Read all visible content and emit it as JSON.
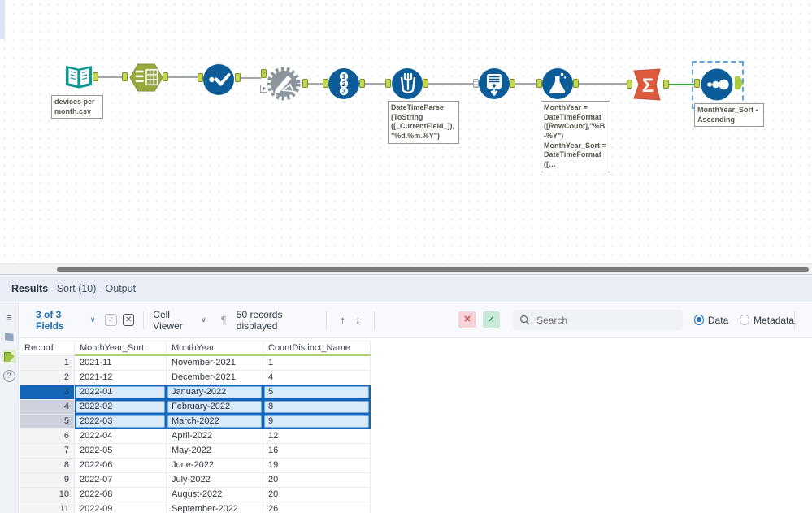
{
  "colors": {
    "tool_blue": "#0b5c99",
    "select_olive": "#98a93e",
    "input_teal": "#109a94",
    "summarize_orange": "#dd5a3e",
    "anchor_green": "#c5d653",
    "connection_green": "#37a23b",
    "selection_blue": "#1566bb",
    "selected_row_fill": "#d9eafa",
    "header_underline_green": "#a9d16d",
    "accent_blue": "#1a6fb5"
  },
  "icons": {
    "list": "≡",
    "help": "?",
    "pilcrow": "¶",
    "arrow_up": "↑",
    "arrow_down": "↓",
    "chevron_down": "∨",
    "close": "✕",
    "check": "✓",
    "names": [
      "input-data-icon",
      "select-icon",
      "unique-icon",
      "macro-gear-icon",
      "record-id-icon",
      "multi-field-formula-icon",
      "multi-row-formula-icon",
      "formula-flask-icon",
      "summarize-sigma-icon",
      "sort-icon",
      "search-icon",
      "results-anchor-icon",
      "help-icon",
      "list-icon"
    ]
  },
  "canvas": {
    "tools": [
      {
        "id": "input-data",
        "label": "devices per month.csv"
      },
      {
        "id": "select"
      },
      {
        "id": "unique"
      },
      {
        "id": "macro"
      },
      {
        "id": "record-id",
        "digits": [
          "1",
          "2",
          "3"
        ]
      },
      {
        "id": "multi-field-formula",
        "annotation": "DateTimeParse\n(ToString\n([_CurrentField_]),\n\"%d.%m.%Y\")"
      },
      {
        "id": "multi-row-formula"
      },
      {
        "id": "formula",
        "annotation": "MonthYear =\nDateTimeFormat\n([RowCount],\"%B\n-%Y\")\nMonthYear_Sort =\nDateTimeFormat\n([…"
      },
      {
        "id": "summarize",
        "glyph": "Σ"
      },
      {
        "id": "sort",
        "annotation": "MonthYear_Sort -\nAscending",
        "selected": true
      }
    ]
  },
  "results": {
    "title": "Results",
    "subtitle": "- Sort (10) - Output",
    "toolbar": {
      "fields_label": "3 of 3 Fields",
      "cell_viewer_label": "Cell Viewer",
      "records_label": "50 records displayed",
      "search_placeholder": "Search",
      "data_label": "Data",
      "metadata_label": "Metadata"
    },
    "table": {
      "columns": [
        "Record",
        "MonthYear_Sort",
        "MonthYear",
        "CountDistinct_Name"
      ],
      "rows": [
        {
          "record": "1",
          "monthyear_sort": "2021-11",
          "monthyear": "November-2021",
          "count": "1",
          "selected": false,
          "active": false
        },
        {
          "record": "2",
          "monthyear_sort": "2021-12",
          "monthyear": "December-2021",
          "count": "4",
          "selected": false,
          "active": false
        },
        {
          "record": "3",
          "monthyear_sort": "2022-01",
          "monthyear": "January-2022",
          "count": "5",
          "selected": true,
          "active": true
        },
        {
          "record": "4",
          "monthyear_sort": "2022-02",
          "monthyear": "February-2022",
          "count": "8",
          "selected": true,
          "active": false
        },
        {
          "record": "5",
          "monthyear_sort": "2022-03",
          "monthyear": "March-2022",
          "count": "9",
          "selected": true,
          "active": false
        },
        {
          "record": "6",
          "monthyear_sort": "2022-04",
          "monthyear": "April-2022",
          "count": "12",
          "selected": false,
          "active": false
        },
        {
          "record": "7",
          "monthyear_sort": "2022-05",
          "monthyear": "May-2022",
          "count": "16",
          "selected": false,
          "active": false
        },
        {
          "record": "8",
          "monthyear_sort": "2022-06",
          "monthyear": "June-2022",
          "count": "19",
          "selected": false,
          "active": false
        },
        {
          "record": "9",
          "monthyear_sort": "2022-07",
          "monthyear": "July-2022",
          "count": "20",
          "selected": false,
          "active": false
        },
        {
          "record": "10",
          "monthyear_sort": "2022-08",
          "monthyear": "August-2022",
          "count": "20",
          "selected": false,
          "active": false
        },
        {
          "record": "11",
          "monthyear_sort": "2022-09",
          "monthyear": "September-2022",
          "count": "26",
          "selected": false,
          "active": false
        }
      ]
    }
  }
}
